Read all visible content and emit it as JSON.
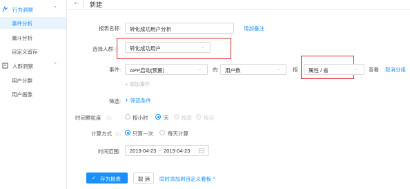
{
  "sidebar": {
    "groups": [
      {
        "label": "行为洞察",
        "icon": "behavior-icon"
      },
      {
        "label": "人群洞察",
        "icon": "crowd-icon"
      }
    ],
    "behavior_items": [
      {
        "label": "事件分析"
      },
      {
        "label": "漏斗分析"
      },
      {
        "label": "自定义留存"
      }
    ],
    "crowd_items": [
      {
        "label": "用户分群"
      },
      {
        "label": "用户画像"
      }
    ]
  },
  "header": {
    "back_icon": "arrow-left-icon",
    "title": "新建"
  },
  "form": {
    "report_name": {
      "label": "报表名称:",
      "value": "转化成功用户分析",
      "link": "增加备注"
    },
    "crowd": {
      "label": "选择人群",
      "value": "转化成功用户"
    },
    "event": {
      "label": "事件:",
      "value": "APP启动(预置)",
      "of": "的",
      "metric": "用户数",
      "by": "按",
      "group_by": "属性 / 省",
      "view": "查看",
      "cancel_group": "取消分组",
      "add_event": "添加事件"
    },
    "filter": {
      "label": "筛选:",
      "add": "筛选条件"
    },
    "granularity": {
      "label": "时间颗粒度",
      "options": [
        {
          "label": "按小时",
          "state": "off"
        },
        {
          "label": "天",
          "state": "on"
        },
        {
          "label": "按周",
          "state": "disabled"
        },
        {
          "label": "按月",
          "state": "disabled"
        }
      ]
    },
    "calc": {
      "label": "计算方式",
      "options": [
        {
          "label": "只算一次",
          "state": "on"
        },
        {
          "label": "每天计算",
          "state": "off"
        }
      ]
    },
    "time_range": {
      "label": "时间范围:",
      "start": "2019-04-23",
      "sep": "~",
      "end": "2019-04-23"
    }
  },
  "actions": {
    "save": "存为报表",
    "cancel": "取 消",
    "dashboard": "同时添加到自定义看板"
  },
  "colors": {
    "accent": "#1890ff",
    "highlight": "#e0262b"
  }
}
